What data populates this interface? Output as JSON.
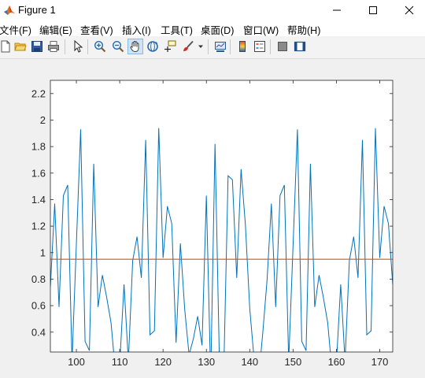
{
  "window": {
    "title": "Figure 1",
    "minimize_glyph": "—",
    "maximize_glyph": "☐",
    "close_glyph": "✕"
  },
  "menu": {
    "items": [
      "文件(F)",
      "编辑(E)",
      "查看(V)",
      "插入(I)",
      "工具(T)",
      "桌面(D)",
      "窗口(W)",
      "帮助(H)"
    ]
  },
  "toolbar": {
    "icons": [
      "new-figure-icon",
      "open-file-icon",
      "save-icon",
      "print-icon",
      "select-arrow-icon",
      "zoom-in-icon",
      "zoom-out-icon",
      "pan-hand-icon",
      "rotate-3d-icon",
      "data-cursor-icon",
      "brush-icon",
      "brush-dropdown-icon",
      "link-plot-icon",
      "colorbar-icon",
      "legend-icon",
      "hide-plot-tools-icon",
      "show-plot-tools-icon"
    ],
    "active": "pan-hand-icon"
  },
  "colors": {
    "series": "#0072BD",
    "reference": "#D95319",
    "axes_bg": "#ffffff",
    "figure_bg": "#f0f0f0"
  },
  "chart_data": {
    "type": "line",
    "title": "",
    "xlabel": "",
    "ylabel": "",
    "xlim": [
      94,
      173
    ],
    "ylim": [
      0.25,
      2.3
    ],
    "xticks": [
      100,
      110,
      120,
      130,
      140,
      150,
      160,
      170
    ],
    "yticks": [
      0.4,
      0.6,
      0.8,
      1,
      1.2,
      1.4,
      1.6,
      1.8,
      2,
      2.2
    ],
    "ytick_labels": [
      "0.4",
      "0.6",
      "0.8",
      "1",
      "1.2",
      "1.4",
      "1.6",
      "1.8",
      "2",
      "2.2"
    ],
    "grid": false,
    "legend": "none",
    "series": [
      {
        "x": [
          94,
          95,
          96,
          97,
          98,
          99,
          100,
          101,
          102,
          103,
          104,
          105,
          106,
          107,
          108,
          109,
          110,
          111,
          112,
          113,
          114,
          115,
          116,
          117,
          118,
          119,
          120,
          121,
          122,
          123,
          124,
          125,
          126,
          127,
          128,
          129,
          130,
          131,
          132,
          133,
          134,
          135,
          136,
          137,
          138,
          139,
          140,
          141,
          142,
          143,
          144,
          145,
          146,
          147,
          148,
          149,
          150,
          151,
          152,
          153,
          154,
          155,
          156,
          157,
          158,
          159,
          160,
          161,
          162,
          163,
          164,
          165,
          166,
          167,
          168,
          169,
          170,
          171,
          172,
          173
        ],
        "y": [
          0.74,
          1.37,
          0.59,
          1.43,
          1.51,
          0.18,
          1.06,
          1.93,
          0.33,
          0.26,
          1.67,
          0.59,
          0.83,
          0.66,
          0.47,
          0.1,
          0.16,
          0.76,
          0.18,
          0.94,
          1.12,
          0.81,
          1.85,
          0.38,
          0.41,
          1.94,
          0.96,
          1.35,
          1.22,
          0.32,
          1.07,
          0.57,
          0.23,
          0.35,
          0.52,
          0.3,
          1.43,
          0.05,
          1.82,
          0.2,
          0.1,
          1.58,
          1.55,
          0.81,
          1.63,
          1.21,
          0.58,
          0.2,
          0.03,
          0.39,
          0.79,
          1.37,
          0.59,
          1.43,
          1.51,
          0.18,
          1.06,
          1.93,
          0.33,
          0.26,
          1.67,
          0.59,
          0.83,
          0.66,
          0.47,
          0.1,
          0.16,
          0.76,
          0.18,
          0.94,
          1.12,
          0.81,
          1.85,
          0.38,
          0.41,
          1.94,
          0.96,
          1.35,
          1.22,
          0.76
        ]
      },
      {
        "x": [
          94,
          173
        ],
        "y": [
          0.95,
          0.95
        ]
      }
    ]
  }
}
